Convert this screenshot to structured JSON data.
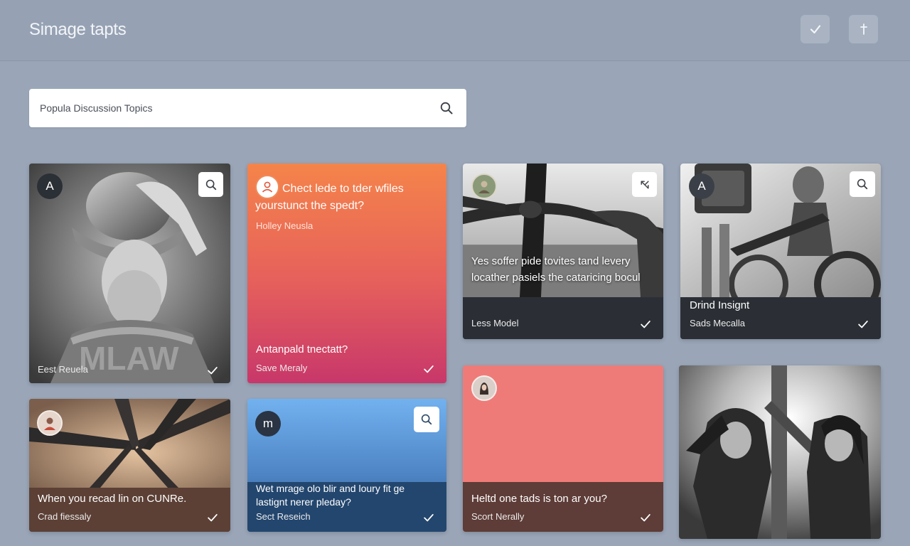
{
  "header": {
    "title": "Simage tapts",
    "btn_check_icon": "check-icon",
    "btn_pin_icon": "pin-icon"
  },
  "search": {
    "placeholder": "Popula Discussion Topics",
    "value": ""
  },
  "cards": {
    "c1": {
      "avatar_letter": "A",
      "sub": "Eest Reuela"
    },
    "c2": {
      "headline": "Chect lede to tder wfiles yourstunct the spedt?",
      "author": "Holley Neusla",
      "title": "Antanpald tnectatt?",
      "sub": "Save Meraly"
    },
    "c3": {
      "overlay": "Yes soffer pide tovites tand levery locather pasiels the cataricing bocul",
      "sub": "Less Model"
    },
    "c4": {
      "avatar_letter": "A",
      "title": "Drind Insignt",
      "sub": "Sads Mecalla"
    },
    "c5": {
      "title": "When you recad lin on CUNRe.",
      "sub": "Crad fiessaly"
    },
    "c6": {
      "avatar_letter": "m",
      "title": "Wet mrage olo blir and loury fit ge lastignt nerer pleday?",
      "sub": "Sect Reseich"
    },
    "c7": {
      "title": "Heltd one tads is ton ar you?",
      "sub": "Scort Nerally"
    },
    "c8": {}
  },
  "colors": {
    "background": "#9aa6b8",
    "card_footer_dark": "#2b2f35",
    "orange_top": "#f5844a",
    "pink_bottom": "#c8376a",
    "blue_top": "#72b1ef",
    "coral": "#ef7b78",
    "brown_footer": "#5c4036"
  }
}
